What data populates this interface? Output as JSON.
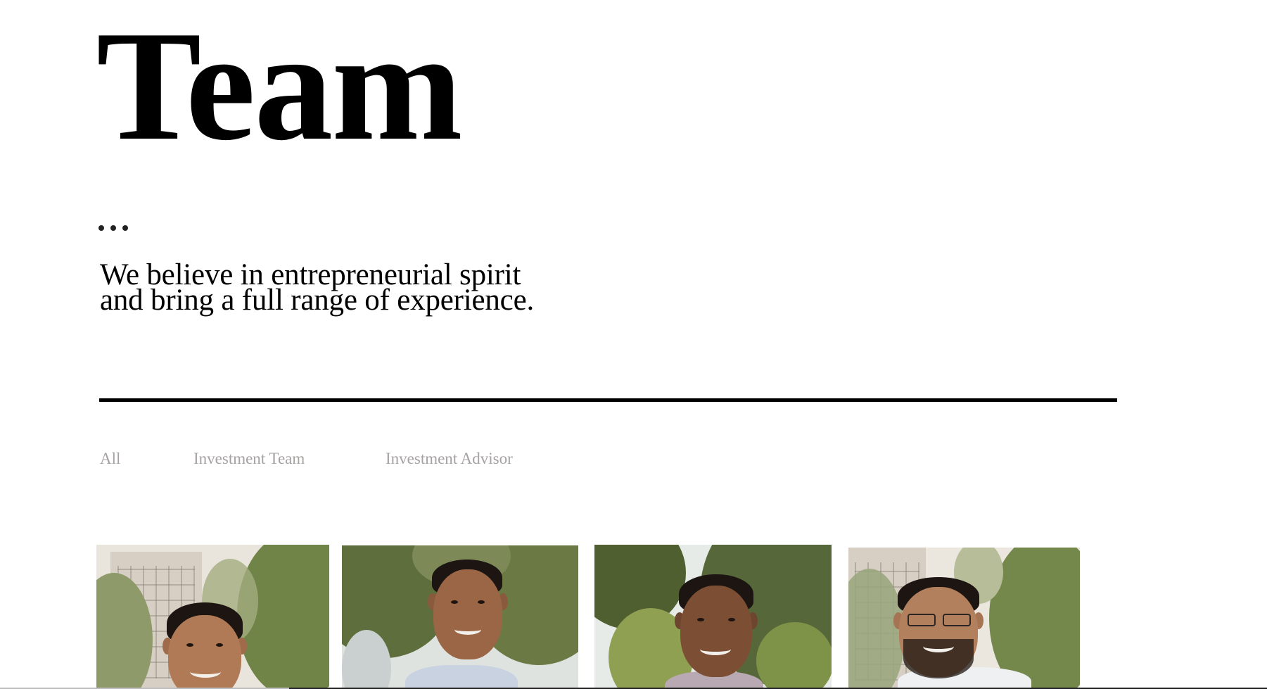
{
  "page": {
    "title": "Team",
    "tagline_line1": "We believe in entrepreneurial spirit",
    "tagline_line2": "and bring a full range of experience."
  },
  "filters": [
    {
      "label": "All"
    },
    {
      "label": "Investment Team"
    },
    {
      "label": "Investment Advisor"
    }
  ],
  "colors": {
    "text": "#000000",
    "filter_text": "#a6a2a2",
    "divider": "#000000",
    "background": "#ffffff"
  },
  "team_photos": [
    {
      "name": "team-member-photo-1",
      "icon": "person-photo"
    },
    {
      "name": "team-member-photo-2",
      "icon": "person-photo"
    },
    {
      "name": "team-member-photo-3",
      "icon": "person-photo"
    },
    {
      "name": "team-member-photo-4",
      "icon": "person-photo"
    }
  ]
}
